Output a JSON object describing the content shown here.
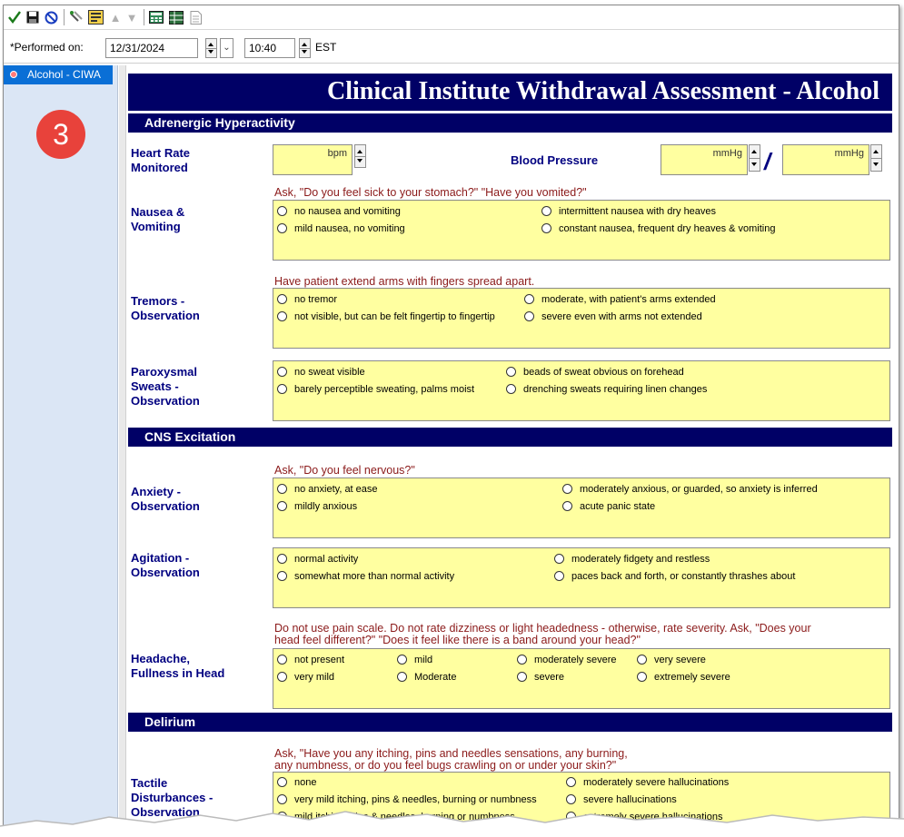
{
  "toolbar": {
    "icons": [
      "check-icon",
      "save-icon",
      "cancel-icon",
      "tools-icon",
      "form-icon",
      "arrow-up-icon",
      "arrow-down-icon",
      "calculator-icon",
      "table-icon",
      "document-icon"
    ]
  },
  "performed": {
    "label": "*Performed on:",
    "date": "12/31/2024",
    "time": "10:40",
    "timezone": "EST"
  },
  "sidebar": {
    "item_label": "Alcohol - CIWA",
    "badge": "3"
  },
  "form": {
    "title": "Clinical Institute Withdrawal Assessment - Alcohol",
    "sections": {
      "adrenergic": "Adrenergic Hyperactivity",
      "cns": "CNS Excitation",
      "delirium": "Delirium"
    },
    "heart_rate": {
      "label_1": "Heart Rate",
      "label_2": "Monitored",
      "unit": "bpm"
    },
    "blood_pressure": {
      "label": "Blood Pressure",
      "unit_1": "mmHg",
      "unit_2": "mmHg",
      "separator": "/"
    },
    "nausea": {
      "label_1": "Nausea &",
      "label_2": "Vomiting",
      "instruction": "Ask, \"Do you feel sick to your stomach?\" \"Have you vomited?\"",
      "options": [
        "no nausea and vomiting",
        "intermittent nausea with dry heaves",
        "mild nausea, no vomiting",
        "constant nausea, frequent dry heaves & vomiting"
      ]
    },
    "tremors": {
      "label_1": "Tremors -",
      "label_2": "Observation",
      "instruction": "Have patient extend arms with fingers spread apart.",
      "options": [
        "no tremor",
        "moderate, with patient's arms extended",
        "not visible, but can be felt fingertip to fingertip",
        "severe even with arms not extended"
      ]
    },
    "sweats": {
      "label_1": "Paroxysmal",
      "label_2": "Sweats -",
      "label_3": "Observation",
      "options": [
        "no sweat visible",
        "beads of sweat obvious on forehead",
        "barely perceptible sweating, palms moist",
        "drenching sweats requiring linen changes"
      ]
    },
    "anxiety": {
      "label_1": "Anxiety -",
      "label_2": "Observation",
      "instruction": "Ask, \"Do you feel nervous?\"",
      "options": [
        "no anxiety, at ease",
        "moderately anxious, or guarded, so anxiety is inferred",
        "mildly anxious",
        "acute panic state"
      ]
    },
    "agitation": {
      "label_1": "Agitation -",
      "label_2": "Observation",
      "options": [
        "normal activity",
        "moderately fidgety and restless",
        "somewhat more than normal activity",
        "paces back and forth, or constantly thrashes about"
      ]
    },
    "headache": {
      "label_1": "Headache,",
      "label_2": "Fullness in Head",
      "instruction_1": "Do not use pain scale.  Do not rate dizziness or light headedness - otherwise, rate severity.  Ask, \"Does your",
      "instruction_2": "head feel different?\"  \"Does it feel like there is a band around your head?\"",
      "options": [
        "not present",
        "mild",
        "moderately severe",
        "very severe",
        "very mild",
        "Moderate",
        "severe",
        "extremely severe"
      ]
    },
    "tactile": {
      "label_1": "Tactile",
      "label_2": "Disturbances -",
      "label_3": "Observation",
      "instruction_1": "Ask, \"Have you any itching, pins and needles sensations, any burning,",
      "instruction_2": "any numbness, or do you feel bugs crawling on or under your skin?\"",
      "options": [
        "none",
        "moderately severe hallucinations",
        "very mild itching, pins & needles, burning or numbness",
        "severe hallucinations",
        "mild itching, pins & needles, burning or numbness",
        "extremely severe hallucinations"
      ]
    }
  }
}
